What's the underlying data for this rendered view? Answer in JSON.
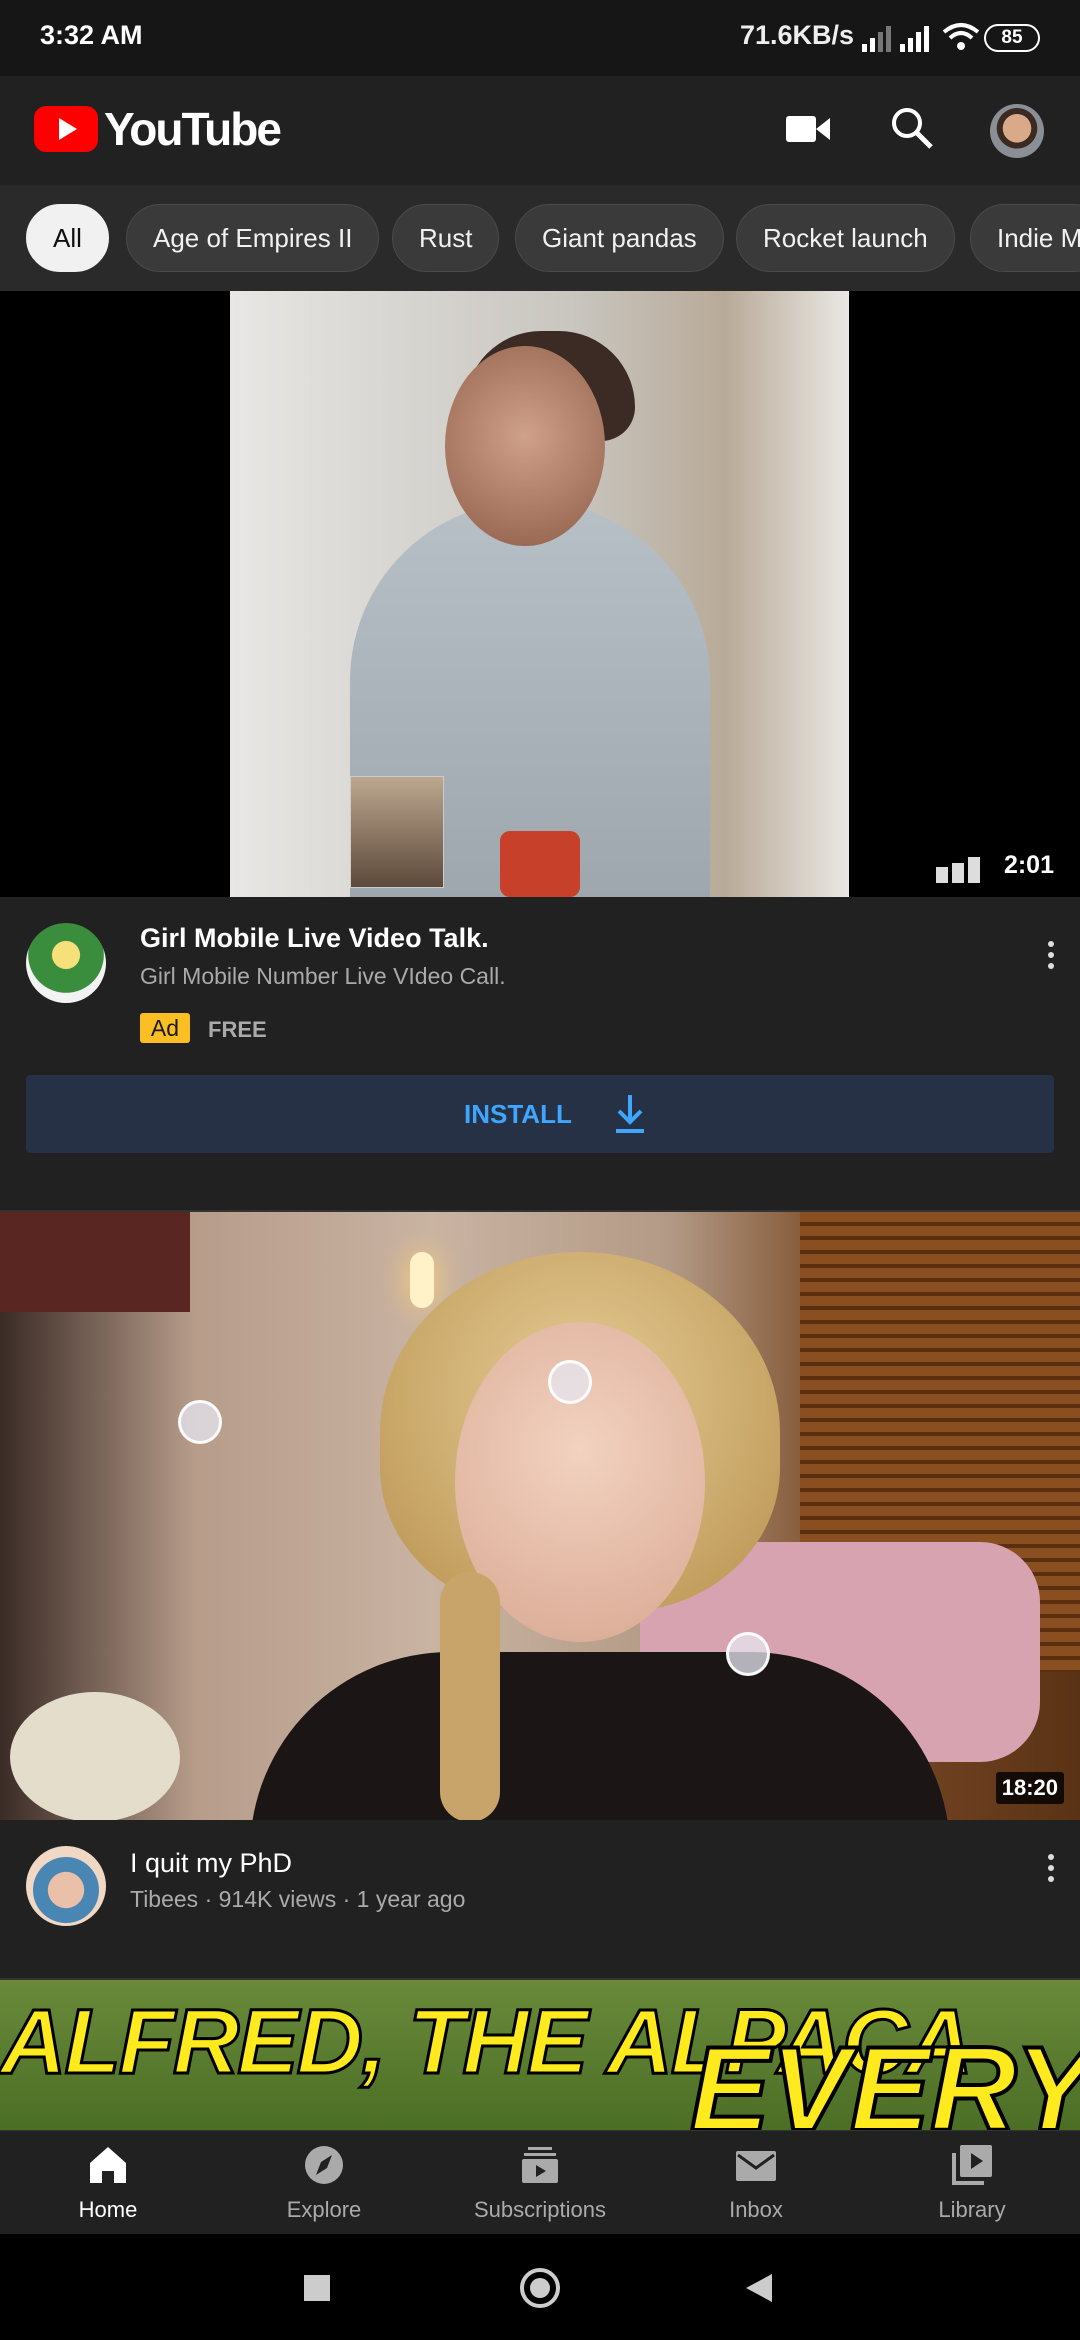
{
  "status_bar": {
    "time": "3:32 AM",
    "network_speed": "71.6KB/s",
    "battery": "85"
  },
  "header": {
    "logo_text": "YouTube"
  },
  "chips": [
    {
      "label": "All",
      "active": true
    },
    {
      "label": "Age of Empires II"
    },
    {
      "label": "Rust"
    },
    {
      "label": "Giant pandas"
    },
    {
      "label": "Rocket launch"
    },
    {
      "label": "Indie M"
    }
  ],
  "ad": {
    "duration": "2:01",
    "title": "Girl Mobile Live Video Talk.",
    "subtitle": "Girl Mobile Number Live VIdeo Call.",
    "badge": "Ad",
    "price": "FREE",
    "install_label": "INSTALL"
  },
  "video2": {
    "duration": "18:20",
    "title": "I quit my PhD",
    "meta": "Tibees · 914K views · 1 year ago"
  },
  "video3": {
    "thumb_text_1": "ALFRED, THE ALPACA",
    "thumb_text_2": "EVERY"
  },
  "bottom_nav": [
    {
      "label": "Home",
      "icon": "home-icon",
      "active": true
    },
    {
      "label": "Explore",
      "icon": "compass-icon"
    },
    {
      "label": "Subscriptions",
      "icon": "subscriptions-icon"
    },
    {
      "label": "Inbox",
      "icon": "mail-icon"
    },
    {
      "label": "Library",
      "icon": "library-icon"
    }
  ]
}
